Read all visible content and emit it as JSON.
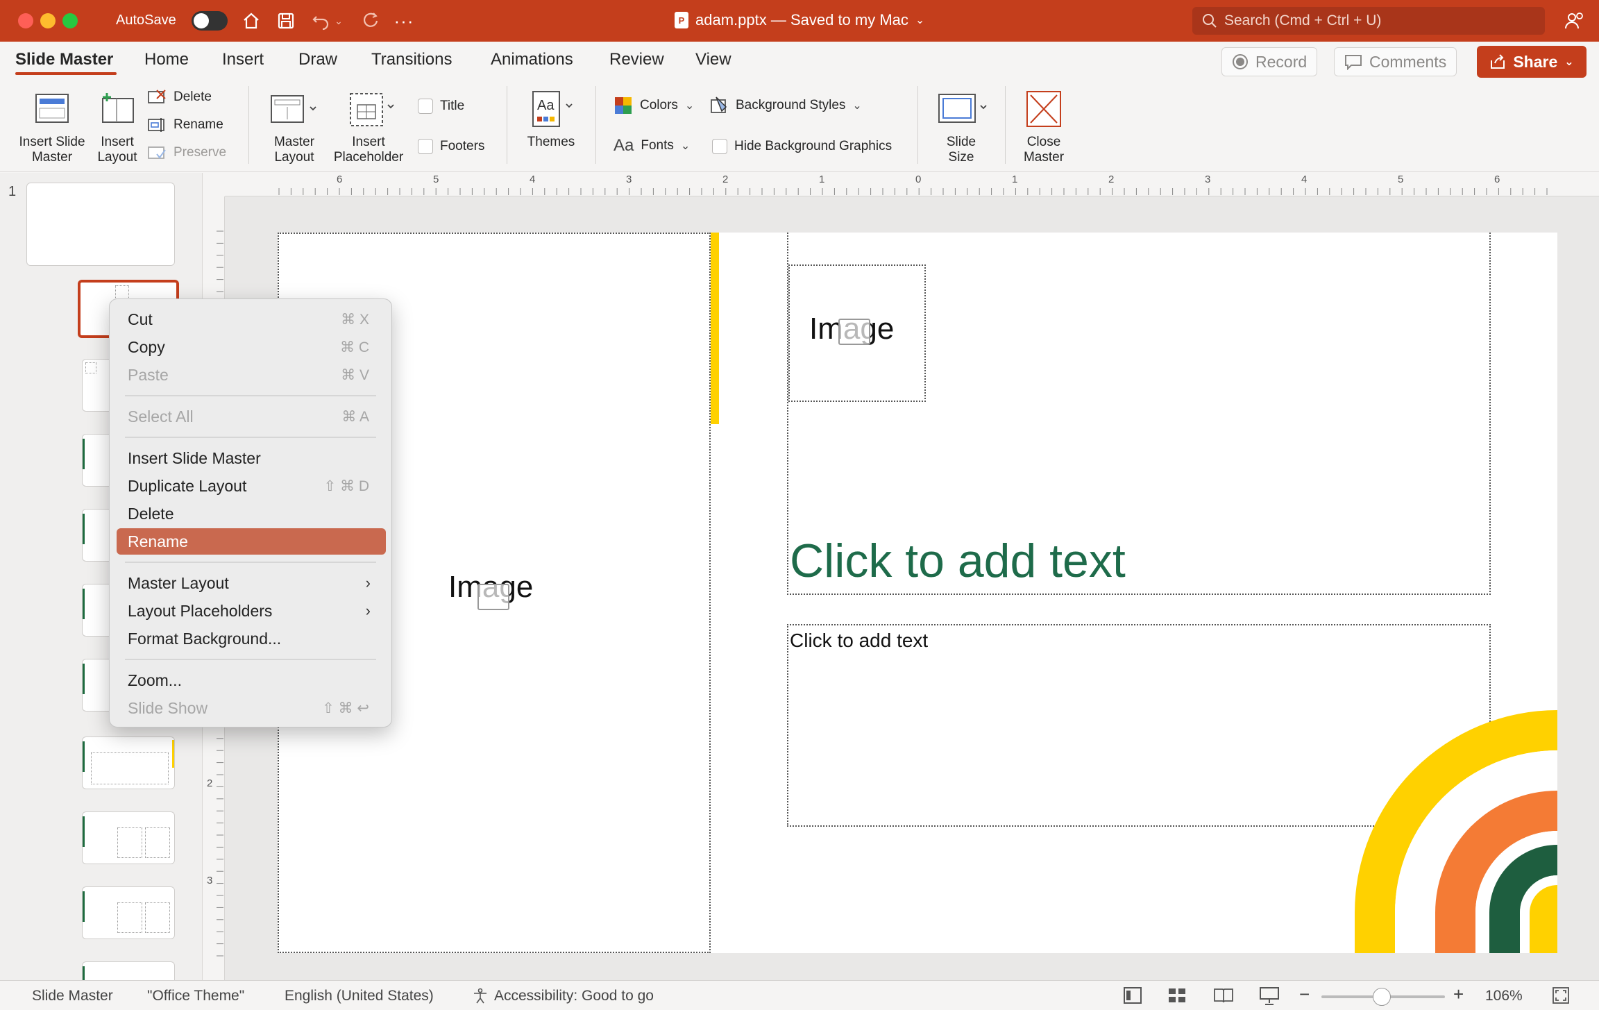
{
  "titlebar": {
    "autosave_label": "AutoSave",
    "doc_title": "adam.pptx — Saved to my Mac",
    "search_placeholder": "Search (Cmd + Ctrl + U)",
    "app_badge": "P"
  },
  "tabs": [
    {
      "label": "Slide Master",
      "active": true
    },
    {
      "label": "Home"
    },
    {
      "label": "Insert"
    },
    {
      "label": "Draw"
    },
    {
      "label": "Transitions"
    },
    {
      "label": "Animations"
    },
    {
      "label": "Review"
    },
    {
      "label": "View"
    }
  ],
  "actions": {
    "record": "Record",
    "comments": "Comments",
    "share": "Share"
  },
  "ribbon": {
    "insert_slide_master": [
      "Insert Slide",
      "Master"
    ],
    "insert_layout": [
      "Insert",
      "Layout"
    ],
    "delete": "Delete",
    "rename": "Rename",
    "preserve": "Preserve",
    "master_layout": [
      "Master",
      "Layout"
    ],
    "insert_placeholder": [
      "Insert",
      "Placeholder"
    ],
    "title": "Title",
    "footers": "Footers",
    "themes": "Themes",
    "colors": "Colors",
    "fonts": "Fonts",
    "background_styles": "Background Styles",
    "hide_background_graphics": "Hide Background Graphics",
    "slide_size": [
      "Slide",
      "Size"
    ],
    "close_master": [
      "Close",
      "Master"
    ],
    "fonts_glyph": "Aa",
    "themes_glyph": "Aa"
  },
  "thumbnails": {
    "number": "1"
  },
  "ruler": {
    "h_ticks": [
      "6",
      "5",
      "4",
      "3",
      "2",
      "1",
      "0",
      "1",
      "2",
      "3",
      "4",
      "5",
      "6"
    ],
    "v_ticks": [
      "2",
      "3"
    ]
  },
  "slide": {
    "image_label_left": "Image",
    "image_label_right": "Image",
    "title_placeholder": "Click to add text",
    "body_placeholder": "Click to add text"
  },
  "context_menu": {
    "items": [
      {
        "label": "Cut",
        "shortcut": "⌘ X",
        "disabled": false
      },
      {
        "label": "Copy",
        "shortcut": "⌘ C",
        "disabled": false
      },
      {
        "label": "Paste",
        "shortcut": "⌘ V",
        "disabled": true
      },
      {
        "label": "Select All",
        "shortcut": "⌘ A",
        "disabled": true
      },
      {
        "label": "Insert Slide Master",
        "shortcut": "",
        "disabled": false
      },
      {
        "label": "Duplicate Layout",
        "shortcut": "⇧ ⌘ D",
        "disabled": false
      },
      {
        "label": "Delete",
        "shortcut": "",
        "disabled": false
      },
      {
        "label": "Rename",
        "shortcut": "",
        "disabled": false,
        "highlighted": true
      },
      {
        "label": "Master Layout",
        "submenu": true
      },
      {
        "label": "Layout Placeholders",
        "submenu": true
      },
      {
        "label": "Format Background...",
        "shortcut": ""
      },
      {
        "label": "Zoom...",
        "shortcut": ""
      },
      {
        "label": "Slide Show",
        "shortcut": "⇧ ⌘ ↩",
        "disabled": true
      }
    ]
  },
  "statusbar": {
    "view": "Slide Master",
    "theme": "\"Office Theme\"",
    "language": "English (United States)",
    "accessibility": "Accessibility: Good to go",
    "zoom": "106%"
  },
  "colors": {
    "accent": "#c43e1c",
    "title_green": "#1e6b4a",
    "yellow": "#ffd100",
    "orange": "#f47b35",
    "dark_green": "#1e5e3f"
  }
}
